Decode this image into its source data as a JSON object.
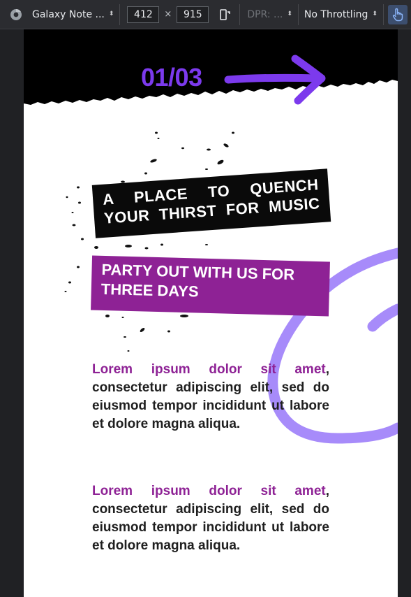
{
  "devtools": {
    "device_name": "Galaxy Note ...",
    "width": "412",
    "times": "×",
    "height": "915",
    "dpr_label": "DPR: ...",
    "throttling": "No Throttling",
    "updown": "⬍"
  },
  "page": {
    "counter": "01/03",
    "tag_black": "A PLACE TO QUENCH YOUR THIRST FOR MUSIC",
    "tag_purple": "PARTY OUT WITH US FOR THREE DAYS",
    "paragraphs": [
      {
        "lead": "Lorem ipsum dolor sit amet",
        "body": ", consectetur adipiscing elit, sed do eiusmod tempor incididunt ut labore et dolore magna aliqua."
      },
      {
        "lead": "Lorem ipsum dolor sit amet",
        "body": ", consectetur adipiscing elit, sed do eiusmod tempor incididunt ut labore et dolore magna aliqua."
      }
    ]
  },
  "colors": {
    "accent_purple": "#7c3aed",
    "tag_purple": "#8e2295",
    "swirl": "#a78bfa",
    "toolbar_bg": "#2b2c30"
  },
  "icons": {
    "browser": "chrome-icon",
    "rotate": "rotate-icon",
    "touch": "touch-hand-icon",
    "arrow": "arrow-right-icon"
  }
}
